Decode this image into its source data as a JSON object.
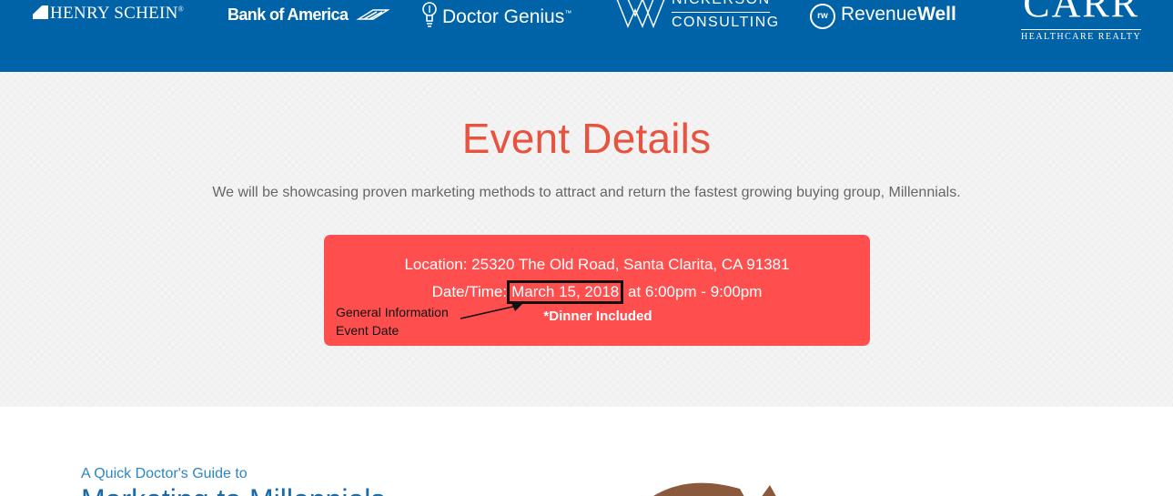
{
  "sponsors": {
    "henry_schein": "Henry Schein",
    "henry_schein_mark": "®",
    "bank_of_america": "Bank of America",
    "doctor_genius": "Doctor Genius",
    "doctor_genius_mark": "™",
    "nickerson_name": "NICKERSON",
    "nickerson_sub": "CONSULTING",
    "revenuewell_badge": "rw",
    "revenuewell_prefix": "Revenue",
    "revenuewell_suffix": "Well",
    "carr_name": "CARR",
    "carr_sub": "HEALTHCARE REALTY"
  },
  "event": {
    "title": "Event Details",
    "subtitle": "We will be showcasing proven marketing methods to attract and return the fastest growing buying group, Millennials.",
    "location": "Location: 25320 The Old Road, Santa Clarita, CA 91381",
    "datetime_prefix": "Date/Time:",
    "date": "March 15, 2018",
    "time": "at 6:00pm - 9:00pm",
    "dinner": "*Dinner Included"
  },
  "annotation": {
    "line1": "General Information",
    "line2": "Event Date"
  },
  "guide": {
    "kicker": "A Quick Doctor's Guide to",
    "title": "Marketing to Millennials"
  },
  "colors": {
    "sponsor_bar": "#0063a7",
    "title_accent": "#e8533f",
    "card": "#fe4f4e",
    "guide_blue": "#1a6aa8"
  },
  "icons": [
    "henry-schein-logo",
    "bank-of-america-flag-icon",
    "lightbulb-icon",
    "nickerson-w-logo",
    "revenuewell-badge-icon",
    "arrow-icon"
  ]
}
